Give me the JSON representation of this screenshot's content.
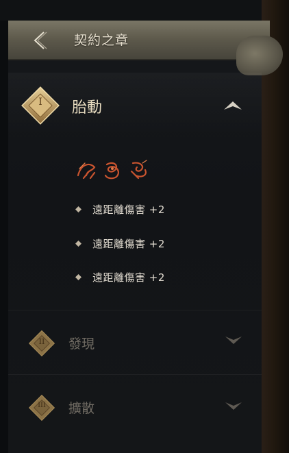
{
  "header": {
    "title": "契約之章",
    "back_icon": "chevron-left-icon"
  },
  "sections": [
    {
      "numeral": "I",
      "title": "胎動",
      "state": "expanded",
      "toggle_icon": "chevron-up-icon",
      "sigil_icons": [
        "beast-sigil-icon",
        "serpent-sigil-icon",
        "dragon-sigil-icon"
      ],
      "bonuses": [
        {
          "text": "遠距離傷害 +2"
        },
        {
          "text": "遠距離傷害 +2"
        },
        {
          "text": "遠距離傷害 +2"
        }
      ]
    },
    {
      "numeral": "II",
      "title": "發現",
      "state": "collapsed",
      "toggle_icon": "chevron-down-icon"
    },
    {
      "numeral": "III",
      "title": "擴散",
      "state": "collapsed",
      "toggle_icon": "chevron-down-icon"
    }
  ],
  "colors": {
    "active_title": "#e8dcc0",
    "inactive_title": "#6f6a62",
    "emblem_gold": "#c8a56a",
    "sigil_red": "#c9542f",
    "bonus_text": "#e2dcd1"
  }
}
